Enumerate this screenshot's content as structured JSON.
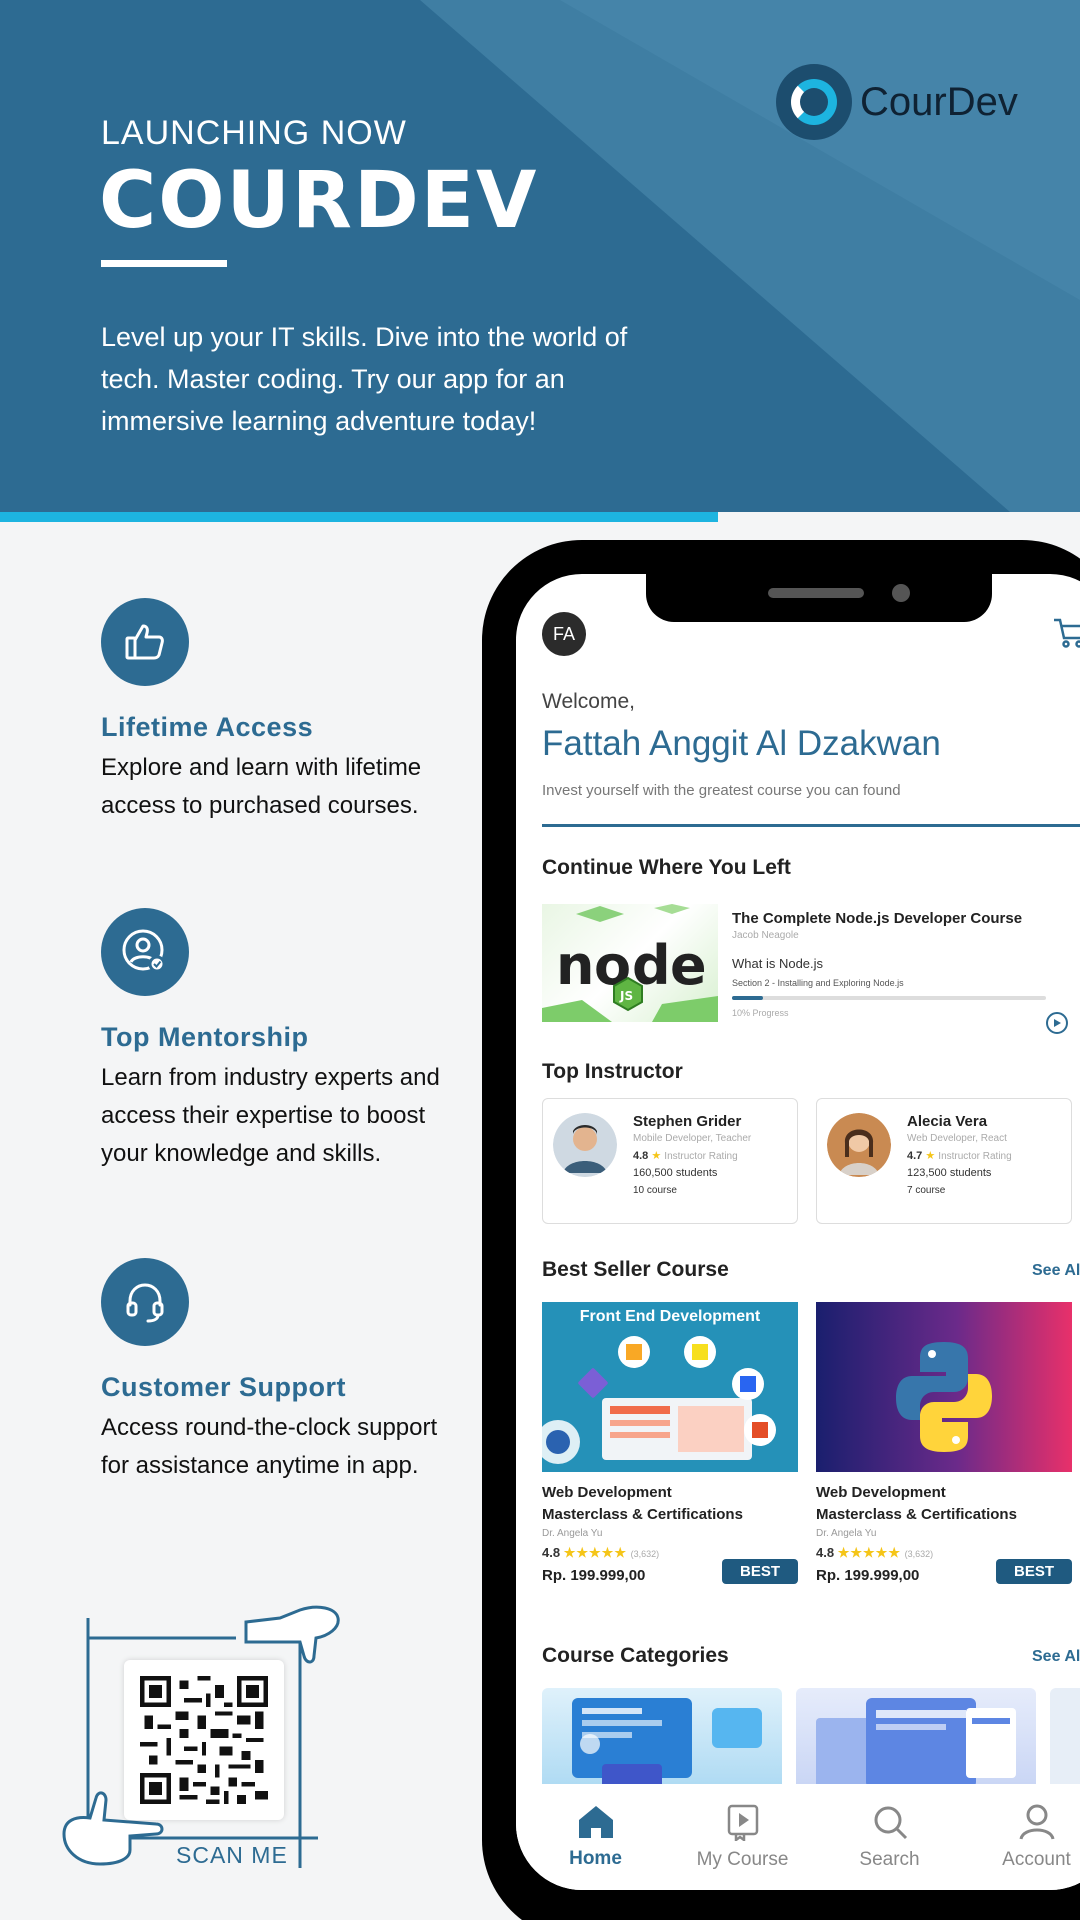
{
  "hero": {
    "kicker": "LAUNCHING NOW",
    "title": "COURDEV",
    "tagline": "Level up your IT skills. Dive into the world of tech. Master coding. Try our app for an immersive learning adventure today!",
    "logo_text": "CourDev",
    "colors": {
      "primary": "#2d6b92",
      "accent": "#1db4e0"
    }
  },
  "features": [
    {
      "icon": "thumbs-up-icon",
      "title": "Lifetime Access",
      "desc": "Explore and learn with lifetime access to purchased courses."
    },
    {
      "icon": "mentor-icon",
      "title": "Top Mentorship",
      "desc": "Learn from industry experts and access their expertise to boost your knowledge and skills."
    },
    {
      "icon": "headset-icon",
      "title": "Customer Support",
      "desc": "Access round-the-clock support for assistance anytime in app."
    }
  ],
  "qr": {
    "label": "SCAN ME"
  },
  "app": {
    "avatar_initials": "FA",
    "welcome": "Welcome,",
    "user_name": "Fattah Anggit Al Dzakwan",
    "subtitle": "Invest yourself with the greatest course you can found",
    "continue": {
      "heading": "Continue Where You Left",
      "course_title": "The Complete Node.js Developer Course",
      "author": "Jacob Neagole",
      "lesson": "What is Node.js",
      "section": "Section 2 - Installing and Exploring Node.js",
      "progress_label": "10% Progress",
      "progress": 0.1
    },
    "instructors": {
      "heading": "Top Instructor",
      "items": [
        {
          "name": "Stephen Grider",
          "role": "Mobile Developer, Teacher",
          "rating": "4.8",
          "rating_label": "Instructor Rating",
          "students": "160,500 students",
          "courses": "10 course"
        },
        {
          "name": "Alecia Vera",
          "role": "Web Developer, React",
          "rating": "4.7",
          "rating_label": "Instructor Rating",
          "students": "123,500 students",
          "courses": "7 course"
        }
      ]
    },
    "best_seller": {
      "heading": "Best Seller Course",
      "see_all": "See All",
      "items": [
        {
          "image_title": "Front End Development",
          "title_line1": "Web Development",
          "title_line2": "Masterclass & Certifications",
          "author": "Dr. Angela Yu",
          "rating": "4.8",
          "stars": "★★★★★",
          "reviews": "(3,632)",
          "price": "Rp. 199.999,00",
          "badge": "BEST"
        },
        {
          "image_title": "",
          "title_line1": "Web Development",
          "title_line2": "Masterclass & Certifications",
          "author": "Dr. Angela Yu",
          "rating": "4.8",
          "stars": "★★★★★",
          "reviews": "(3,632)",
          "price": "Rp. 199.999,00",
          "badge": "BEST"
        }
      ]
    },
    "categories": {
      "heading": "Course Categories",
      "see_all": "See All"
    },
    "tabs": [
      {
        "label": "Home",
        "icon": "home-icon",
        "active": true
      },
      {
        "label": "My Course",
        "icon": "play-book-icon",
        "active": false
      },
      {
        "label": "Search",
        "icon": "search-icon",
        "active": false
      },
      {
        "label": "Account",
        "icon": "user-icon",
        "active": false
      }
    ]
  }
}
